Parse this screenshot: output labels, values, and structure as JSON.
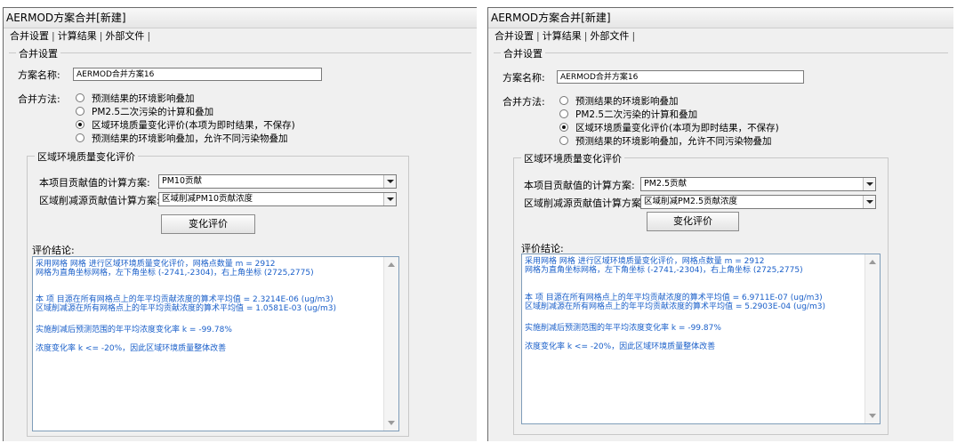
{
  "panels": [
    {
      "title": "AERMOD方案合并[新建]",
      "tabs": [
        "合并设置",
        "计算结果",
        "外部文件"
      ],
      "group_title": "合并设置",
      "scheme_label": "方案名称:",
      "scheme_value": "AERMOD合并方案16",
      "method_label": "合并方法:",
      "methods": [
        "预测结果的环境影响叠加",
        "PM2.5二次污染的计算和叠加",
        "区域环境质量变化评价(本项为即时结果，不保存)",
        "预测结果的环境影响叠加，允许不同污染物叠加"
      ],
      "selected_method_index": 2,
      "region_group_title": "区域环境质量变化评价",
      "project_label": "本项目贡献值的计算方案:",
      "project_value": "PM10贡献",
      "reduction_label": "区域削减源贡献值计算方案:",
      "reduction_value": "区域削减PM10贡献浓度",
      "evaluate_button": "变化评价",
      "conclusion_label": "评价结论:",
      "results": [
        "采用网格 网格 进行区域环境质量变化评价，网格点数量 m = 2912",
        "网格为直角坐标网格，左下角坐标 (-2741,-2304)，右上角坐标 (2725,2775)",
        "",
        "",
        "本 项 目源在所有网格点上的年平均贡献浓度的算术平均值 = 2.3214E-06 (ug/m3)",
        "区域削减源在所有网格点上的年平均贡献浓度的算术平均值 = 1.0581E-03 (ug/m3)",
        "",
        "实施削减后预测范围的年平均浓度变化率 k = -99.78%",
        "",
        "浓度变化率 k <= -20%，因此区域环境质量整体改善"
      ]
    },
    {
      "title": "AERMOD方案合并[新建]",
      "tabs": [
        "合并设置",
        "计算结果",
        "外部文件"
      ],
      "group_title": "合并设置",
      "scheme_label": "方案名称:",
      "scheme_value": "AERMOD合并方案16",
      "method_label": "合并方法:",
      "methods": [
        "预测结果的环境影响叠加",
        "PM2.5二次污染的计算和叠加",
        "区域环境质量变化评价(本项为即时结果，不保存)",
        "预测结果的环境影响叠加，允许不同污染物叠加"
      ],
      "selected_method_index": 2,
      "region_group_title": "区域环境质量变化评价",
      "project_label": "本项目贡献值的计算方案:",
      "project_value": "PM2.5贡献",
      "reduction_label": "区域削减源贡献值计算方案:",
      "reduction_value": "区域削减PM2.5贡献浓度",
      "evaluate_button": "变化评价",
      "conclusion_label": "评价结论:",
      "results": [
        "采用网格 网格 进行区域环境质量变化评价，网格点数量 m = 2912",
        "网格为直角坐标网格，左下角坐标 (-2741,-2304)，右上角坐标 (2725,2775)",
        "",
        "",
        "本 项 目源在所有网格点上的年平均贡献浓度的算术平均值 = 6.9711E-07 (ug/m3)",
        "区域削减源在所有网格点上的年平均贡献浓度的算术平均值 = 5.2903E-04 (ug/m3)",
        "",
        "实施削减后预测范围的年平均浓度变化率 k = -99.87%",
        "",
        "浓度变化率 k <= -20%，因此区域环境质量整体改善"
      ]
    }
  ]
}
